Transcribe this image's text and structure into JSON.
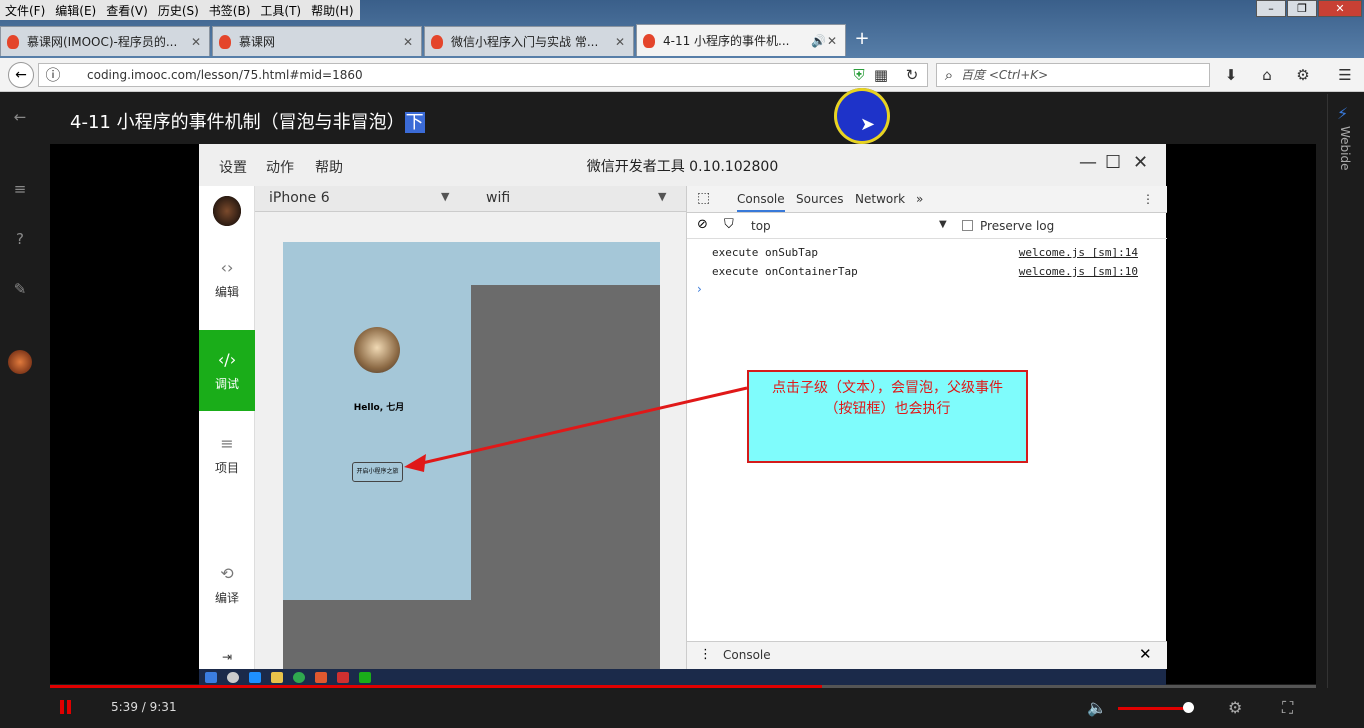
{
  "menubar": [
    "文件(F)",
    "编辑(E)",
    "查看(V)",
    "历史(S)",
    "书签(B)",
    "工具(T)",
    "帮助(H)"
  ],
  "tabs": [
    {
      "label": "慕课网(IMOOC)-程序员的...",
      "active": false
    },
    {
      "label": "慕课网",
      "active": false
    },
    {
      "label": "微信小程序入门与实战 常...",
      "active": false
    },
    {
      "label": "4-11 小程序的事件机...",
      "active": true
    }
  ],
  "address": {
    "url": "coding.imooc.com/lesson/75.html#mid=1860",
    "search_placeholder": "百度 <Ctrl+K>"
  },
  "page": {
    "title_main": "4-11 小程序的事件机制（冒泡与非冒泡）",
    "title_highlight": "下"
  },
  "rightbar": {
    "label": "Webide"
  },
  "devtools": {
    "menu": [
      "设置",
      "动作",
      "帮助"
    ],
    "title": "微信开发者工具 0.10.102800",
    "device": "iPhone 6",
    "network": "wifi",
    "sidebar": [
      {
        "label": "编辑",
        "icon": "code-icon"
      },
      {
        "label": "调试",
        "icon": "debug-icon",
        "active": true
      },
      {
        "label": "项目",
        "icon": "menu-icon"
      },
      {
        "label": "编译",
        "icon": "compile-icon"
      }
    ],
    "phone": {
      "greeting": "Hello, 七月",
      "button": "开启小程序之旅"
    },
    "console": {
      "tabs": [
        "Console",
        "Sources",
        "Network"
      ],
      "context": "top",
      "preserve_log": "Preserve log",
      "logs": [
        {
          "text": "execute onSubTap",
          "source": "welcome.js [sm]:14"
        },
        {
          "text": "execute onContainerTap",
          "source": "welcome.js [sm]:10"
        }
      ],
      "drawer_tab": "Console"
    }
  },
  "annotation": "点击子级（文本），会冒泡，父级事件（按钮框）也会执行",
  "player": {
    "current": "5:39",
    "duration": " / 9:31",
    "progress": 0.61,
    "volume": 0.9
  }
}
